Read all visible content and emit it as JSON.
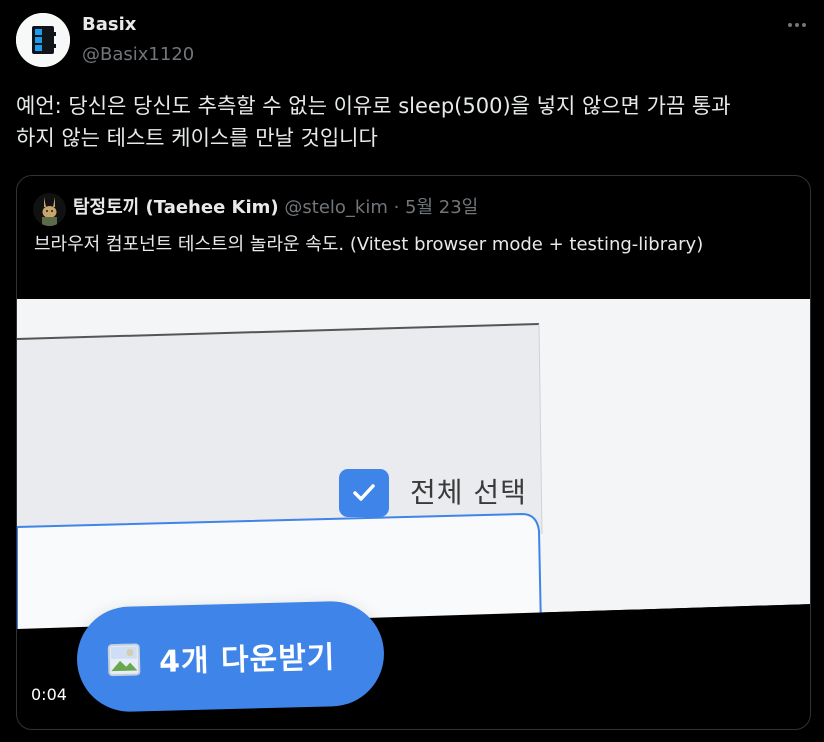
{
  "tweet": {
    "author_name": "Basix",
    "author_handle": "@Basix1120",
    "text": "예언: 당신은 당신도 추측할 수 없는 이유로 sleep(500)을 넣지 않으면 가끔 통과\n하지 않는 테스트 케이스를 만날 것입니다"
  },
  "quoted": {
    "author_name": "탐정토끼 (Taehee Kim)",
    "author_handle": "@stelo_kim",
    "separator": " · ",
    "date": "5월 23일",
    "text": "브라우저 컴포넌트 테스트의 놀라운 속도. (Vitest browser mode + testing-library)",
    "video": {
      "select_all_label": "전체 선택",
      "download_button_label": "4개 다운받기",
      "timestamp": "0:04"
    }
  },
  "icons": {
    "avatar": "basix-logo-icon",
    "more": "more-dots-icon",
    "quoted_avatar": "rabbit-avatar-icon",
    "checkbox": "checkmark-icon",
    "download": "image-icon"
  },
  "colors": {
    "background": "#000000",
    "text_primary": "#e7e9ea",
    "text_secondary": "#71767b",
    "border": "#2f3336",
    "accent_blue": "#3f84e8"
  }
}
